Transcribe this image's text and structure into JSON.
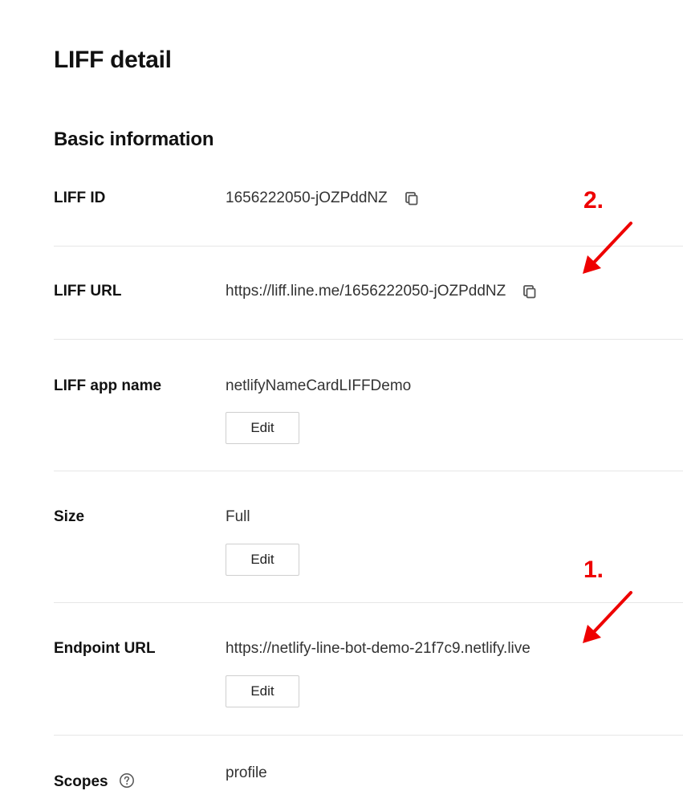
{
  "page": {
    "title": "LIFF detail"
  },
  "section": {
    "title": "Basic information"
  },
  "fields": {
    "liff_id": {
      "label": "LIFF ID",
      "value": "1656222050-jOZPddNZ",
      "icon": "copy-icon"
    },
    "liff_url": {
      "label": "LIFF URL",
      "value": "https://liff.line.me/1656222050-jOZPddNZ",
      "icon": "copy-icon"
    },
    "app_name": {
      "label": "LIFF app name",
      "value": "netlifyNameCardLIFFDemo",
      "edit_label": "Edit"
    },
    "size": {
      "label": "Size",
      "value": "Full",
      "edit_label": "Edit"
    },
    "endpoint": {
      "label": "Endpoint URL",
      "value": "https://netlify-line-bot-demo-21f7c9.netlify.live",
      "edit_label": "Edit"
    },
    "scopes": {
      "label": "Scopes",
      "value": "profile",
      "icon": "help-circle-icon"
    }
  },
  "annotations": {
    "one": "1.",
    "two": "2.",
    "color": "#ee0000"
  }
}
